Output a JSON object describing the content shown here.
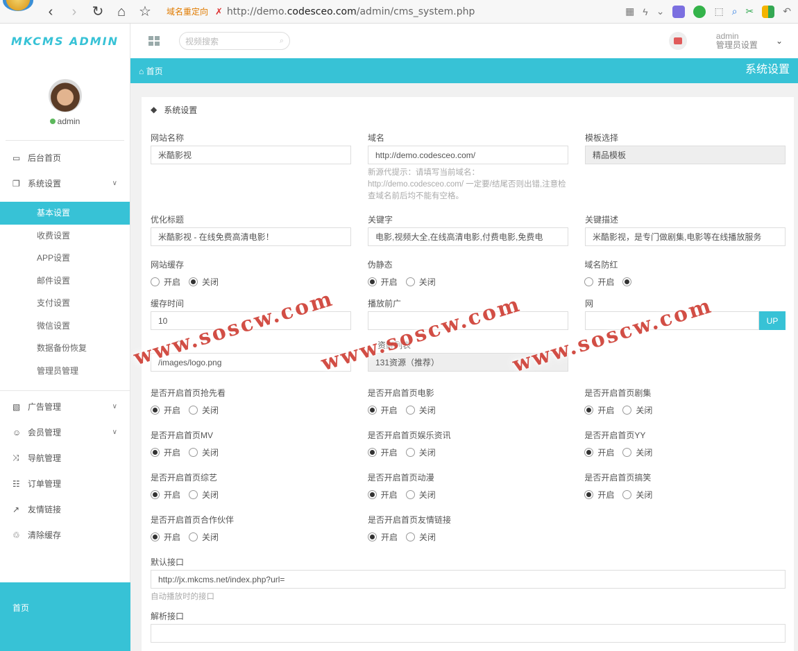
{
  "browser": {
    "redirect_label": "域名重定向",
    "url_prefix": "http://demo.",
    "url_domain": "codesceo.com",
    "url_path": "/admin/cms_system.php"
  },
  "sidebar": {
    "brand": "MKCMS ADMIN",
    "username": "admin",
    "menu": [
      {
        "label": "后台首页",
        "icon": "laptop-icon"
      },
      {
        "label": "系统设置",
        "icon": "copy-icon"
      }
    ],
    "sub_items": [
      "基本设置",
      "收费设置",
      "APP设置",
      "邮件设置",
      "支付设置",
      "微信设置",
      "数据备份恢复",
      "管理员管理"
    ],
    "menu2": [
      {
        "label": "广告管理",
        "icon": "image-icon"
      },
      {
        "label": "会员管理",
        "icon": "users-icon"
      },
      {
        "label": "导航管理",
        "icon": "random-icon"
      },
      {
        "label": "订单管理",
        "icon": "cart-icon"
      },
      {
        "label": "友情链接",
        "icon": "external-link-icon"
      },
      {
        "label": "清除缓存",
        "icon": "trash-icon"
      }
    ],
    "footer_label": "首页"
  },
  "header": {
    "search_placeholder": "视频搜索",
    "admin_name": "admin",
    "admin_sub": "管理员设置"
  },
  "crumb": {
    "home": "首页",
    "title": "系统设置"
  },
  "panel": {
    "title": "系统设置",
    "site_name_label": "网站名称",
    "site_name_value": "米酷影视",
    "domain_label": "域名",
    "domain_value": "http://demo.codesceo.com/",
    "domain_hint": "新源代提示：请填写当前域名：http://demo.codesceo.com/ 一定要/结尾否则出错,注意检查域名前后均不能有空格。",
    "template_label": "模板选择",
    "template_value": "精品模板",
    "seo_title_label": "优化标题",
    "seo_title_value": "米酷影视 - 在线免费高清电影！",
    "keywords_label": "关键字",
    "keywords_value": "电影,视频大全,在线高清电影,付费电影,免费电",
    "desc_label": "关键描述",
    "desc_value": "米酷影视，是专门做剧集,电影等在线播放服务",
    "cache_label": "网站缓存",
    "static_label": "伪静态",
    "antired_label": "域名防红",
    "cache_time_label": "缓存时间",
    "cache_time_value": "10",
    "pre_ad_label": "播放前广",
    "website_label": "网",
    "up_label": "UP",
    "logo_label": "O",
    "logo_value": "/images/logo.png",
    "source_label": "资鲜列表",
    "source_value": "131资源（推荐）",
    "toggles": [
      {
        "label": "是否开启首页抢先看",
        "on": true
      },
      {
        "label": "是否开启首页电影",
        "on": true
      },
      {
        "label": "是否开启首页剧集",
        "on": true
      },
      {
        "label": "是否开启首页MV",
        "on": true
      },
      {
        "label": "是否开启首页娱乐资讯",
        "on": true
      },
      {
        "label": "是否开启首页YY",
        "on": true
      },
      {
        "label": "是否开启首页综艺",
        "on": true
      },
      {
        "label": "是否开启首页动漫",
        "on": true
      },
      {
        "label": "是否开启首页搞笑",
        "on": true
      },
      {
        "label": "是否开启首页合作伙伴",
        "on": true
      },
      {
        "label": "是否开启首页友情链接",
        "on": true
      }
    ],
    "on_label": "开启",
    "off_label": "关闭",
    "default_api_label": "默认接口",
    "default_api_value": "http://jx.mkcms.net/index.php?url=",
    "default_api_hint": "自动播放时的接口",
    "parse_api_label": "解析接口"
  },
  "watermark": "www.soscw.com",
  "colors": {
    "accent": "#37c2d6",
    "watermark": "#d0453c",
    "underline": "#f27c62"
  }
}
